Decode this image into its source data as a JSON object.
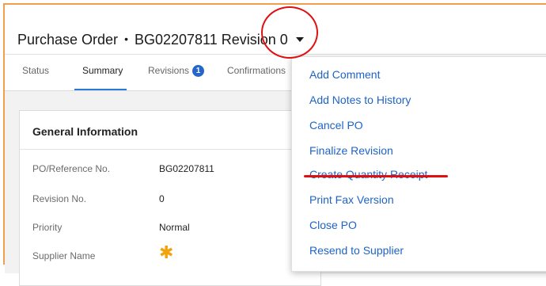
{
  "header": {
    "doc_type": "Purchase Order",
    "separator": "•",
    "doc_number_revision": "BG02207811 Revision 0"
  },
  "tabs": [
    {
      "label": "Status"
    },
    {
      "label": "Summary"
    },
    {
      "label": "Revisions",
      "badge": "1"
    },
    {
      "label": "Confirmations"
    }
  ],
  "general_info": {
    "title": "General Information",
    "rows": [
      {
        "label": "PO/Reference No.",
        "value": "BG02207811"
      },
      {
        "label": "Revision No.",
        "value": "0"
      },
      {
        "label": "Priority",
        "value": "Normal"
      },
      {
        "label": "Supplier Name",
        "value": ""
      }
    ],
    "required_marker": "✱"
  },
  "actions_menu": {
    "items": [
      "Add Comment",
      "Add Notes to History",
      "Cancel PO",
      "Finalize Revision",
      "Create Quantity Receipt",
      "Print Fax Version",
      "Close PO",
      "Resend to Supplier"
    ]
  },
  "colors": {
    "accent_blue": "#2979d9",
    "link_blue": "#1e63c7",
    "annotation_red": "#e01010",
    "required_orange": "#f2a20c"
  }
}
